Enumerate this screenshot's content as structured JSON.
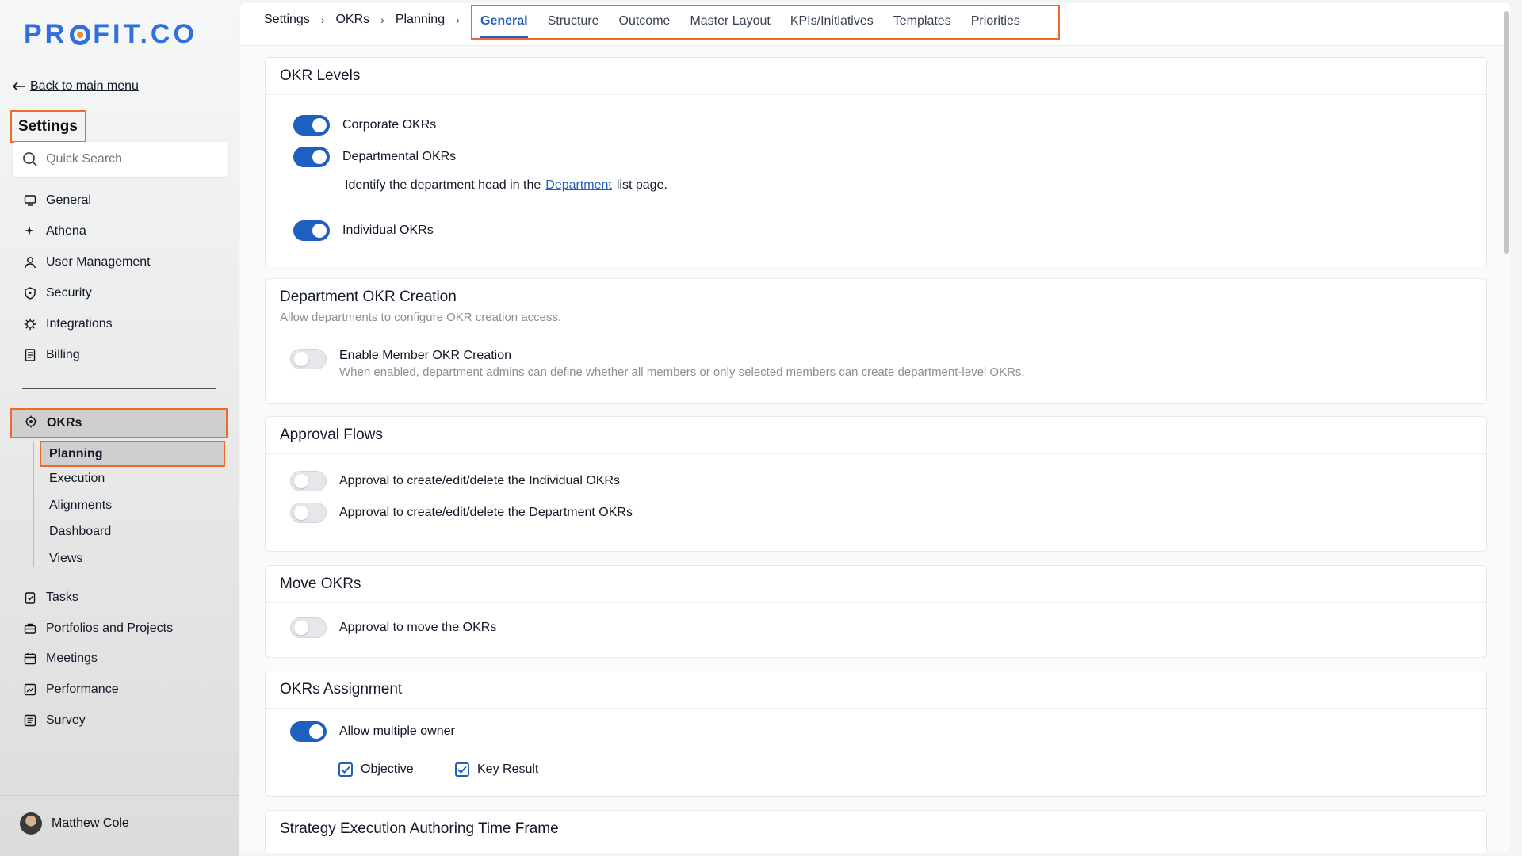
{
  "logo": {
    "text": "PROFIT.CO",
    "part1": "PR",
    "part2": "FIT.CO"
  },
  "sidebar": {
    "back_label": "Back to main menu",
    "settings_title": "Settings",
    "search_placeholder": "Quick Search",
    "items": [
      {
        "label": "General",
        "icon": "monitor-icon"
      },
      {
        "label": "Athena",
        "icon": "sparkle-icon"
      },
      {
        "label": "User Management",
        "icon": "user-icon"
      },
      {
        "label": "Security",
        "icon": "shield-icon"
      },
      {
        "label": "Integrations",
        "icon": "gear-icon"
      },
      {
        "label": "Billing",
        "icon": "receipt-icon"
      }
    ],
    "okrs_label": "OKRs",
    "okr_sub": [
      "Planning",
      "Execution",
      "Alignments",
      "Dashboard",
      "Views"
    ],
    "bottom_items": [
      {
        "label": "Tasks",
        "icon": "clipboard-check-icon"
      },
      {
        "label": "Portfolios and Projects",
        "icon": "briefcase-icon"
      },
      {
        "label": "Meetings",
        "icon": "calendar-icon"
      },
      {
        "label": "Performance",
        "icon": "chart-icon"
      },
      {
        "label": "Survey",
        "icon": "list-icon"
      }
    ],
    "user_name": "Matthew Cole"
  },
  "breadcrumb": [
    "Settings",
    "OKRs",
    "Planning"
  ],
  "tabs": [
    "General",
    "Structure",
    "Outcome",
    "Master Layout",
    "KPIs/Initiatives",
    "Templates",
    "Priorities"
  ],
  "active_tab": "General",
  "okr_levels": {
    "title": "OKR Levels",
    "corporate": "Corporate OKRs",
    "departmental": "Departmental OKRs",
    "dept_note_pre": "Identify the department head in the",
    "dept_note_link": "Department",
    "dept_note_post": "list page.",
    "individual": "Individual OKRs"
  },
  "dept_creation": {
    "title": "Department OKR Creation",
    "subtitle": "Allow departments to configure OKR creation access.",
    "toggle_label": "Enable Member OKR Creation",
    "toggle_desc": "When enabled, department admins can define whether all members or only selected members can create department-level OKRs."
  },
  "approval_flows": {
    "title": "Approval Flows",
    "individual": "Approval to create/edit/delete the Individual OKRs",
    "department": "Approval to create/edit/delete the Department OKRs"
  },
  "move_okrs": {
    "title": "Move OKRs",
    "label": "Approval to move the OKRs"
  },
  "assignment": {
    "title": "OKRs Assignment",
    "multi_owner": "Allow multiple owner",
    "objective": "Objective",
    "key_result": "Key Result"
  },
  "strategy": {
    "title": "Strategy Execution Authoring Time Frame"
  },
  "colors": {
    "accent": "#1f5fbf",
    "highlight": "#ee6a2b",
    "logo_dot": "#f28a2e"
  }
}
